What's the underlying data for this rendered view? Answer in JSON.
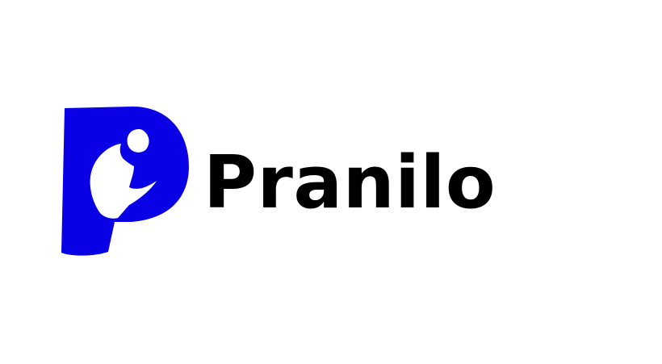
{
  "brand": {
    "name": "Pranilo"
  },
  "colors": {
    "mark": "#0a00e6",
    "wordmark": "#000000",
    "background": "#ffffff"
  },
  "icons": {
    "mark": "letter-p-person-icon"
  }
}
